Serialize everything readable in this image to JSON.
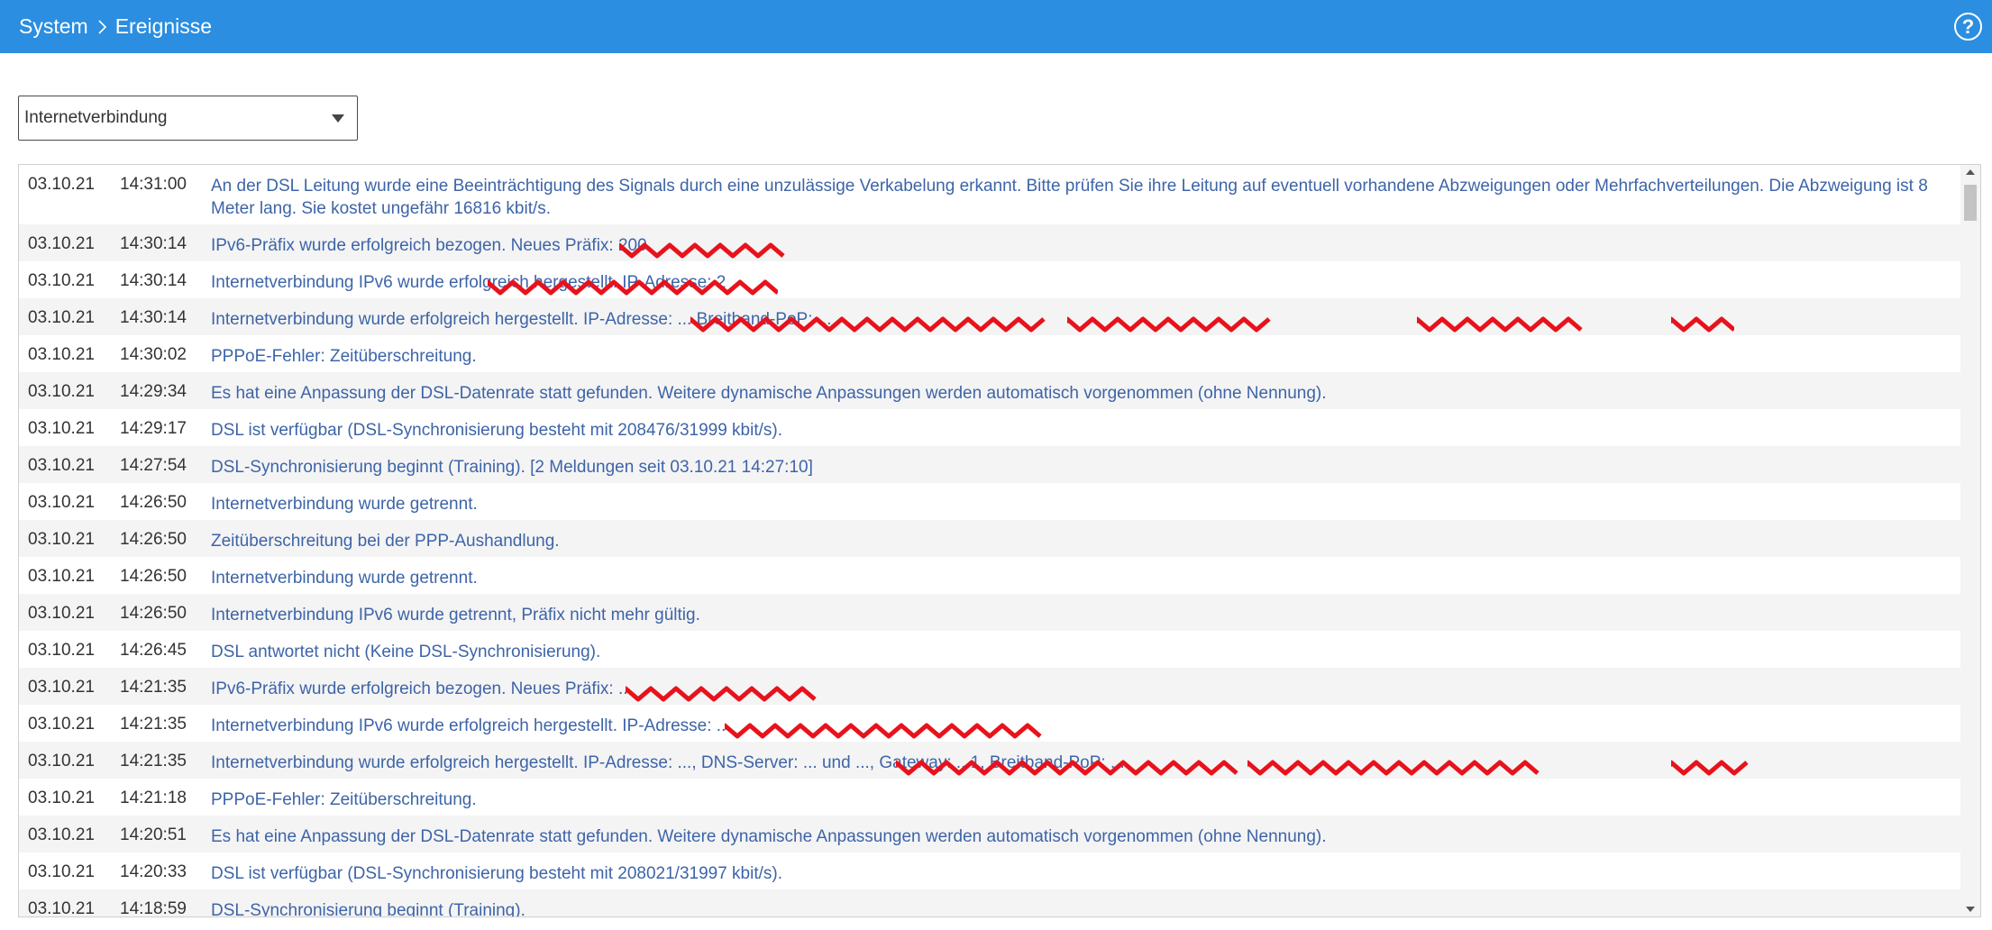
{
  "header": {
    "breadcrumb": [
      "System",
      "Ereignisse"
    ],
    "help_label": "?"
  },
  "filter": {
    "selected": "Internetverbindung"
  },
  "events": [
    {
      "date": "03.10.21",
      "time": "14:31:00",
      "message": "An der DSL Leitung wurde eine Beeinträchtigung des Signals durch eine unzulässige Verkabelung erkannt. Bitte prüfen Sie ihre Leitung auf eventuell vorhandene Abzweigungen oder Mehrfachverteilungen. Die Abzweigung ist 8 Meter lang. Sie kostet ungefähr 16816 kbit/s."
    },
    {
      "date": "03.10.21",
      "time": "14:30:14",
      "message": "IPv6-Präfix wurde erfolgreich bezogen. Neues Präfix: 200"
    },
    {
      "date": "03.10.21",
      "time": "14:30:14",
      "message": "Internetverbindung IPv6 wurde erfolgreich hergestellt. IP-Adresse: 2"
    },
    {
      "date": "03.10.21",
      "time": "14:30:14",
      "message": "Internetverbindung wurde erfolgreich hergestellt. IP-Adresse: ... Breitband-PoP: ..."
    },
    {
      "date": "03.10.21",
      "time": "14:30:02",
      "message": "PPPoE-Fehler: Zeitüberschreitung."
    },
    {
      "date": "03.10.21",
      "time": "14:29:34",
      "message": "Es hat eine Anpassung der DSL-Datenrate statt gefunden. Weitere dynamische Anpassungen werden automatisch vorgenommen (ohne Nennung)."
    },
    {
      "date": "03.10.21",
      "time": "14:29:17",
      "message": "DSL ist verfügbar (DSL-Synchronisierung besteht mit 208476/31999 kbit/s)."
    },
    {
      "date": "03.10.21",
      "time": "14:27:54",
      "message": "DSL-Synchronisierung beginnt (Training). [2 Meldungen seit 03.10.21 14:27:10]"
    },
    {
      "date": "03.10.21",
      "time": "14:26:50",
      "message": "Internetverbindung wurde getrennt."
    },
    {
      "date": "03.10.21",
      "time": "14:26:50",
      "message": "Zeitüberschreitung bei der PPP-Aushandlung."
    },
    {
      "date": "03.10.21",
      "time": "14:26:50",
      "message": "Internetverbindung wurde getrennt."
    },
    {
      "date": "03.10.21",
      "time": "14:26:50",
      "message": "Internetverbindung IPv6 wurde getrennt, Präfix nicht mehr gültig."
    },
    {
      "date": "03.10.21",
      "time": "14:26:45",
      "message": "DSL antwortet nicht (Keine DSL-Synchronisierung)."
    },
    {
      "date": "03.10.21",
      "time": "14:21:35",
      "message": "IPv6-Präfix wurde erfolgreich bezogen. Neues Präfix: ..."
    },
    {
      "date": "03.10.21",
      "time": "14:21:35",
      "message": "Internetverbindung IPv6 wurde erfolgreich hergestellt. IP-Adresse: ..."
    },
    {
      "date": "03.10.21",
      "time": "14:21:35",
      "message": "Internetverbindung wurde erfolgreich hergestellt. IP-Adresse: ..., DNS-Server: ... und ..., Gateway: ...1, Breitband-PoP: ..."
    },
    {
      "date": "03.10.21",
      "time": "14:21:18",
      "message": "PPPoE-Fehler: Zeitüberschreitung."
    },
    {
      "date": "03.10.21",
      "time": "14:20:51",
      "message": "Es hat eine Anpassung der DSL-Datenrate statt gefunden. Weitere dynamische Anpassungen werden automatisch vorgenommen (ohne Nennung)."
    },
    {
      "date": "03.10.21",
      "time": "14:20:33",
      "message": "DSL ist verfügbar (DSL-Synchronisierung besteht mit 208021/31997 kbit/s)."
    },
    {
      "date": "03.10.21",
      "time": "14:18:59",
      "message": "DSL-Synchronisierung beginnt (Training)."
    }
  ],
  "icons": {
    "breadcrumb_separator": "chevron-right-icon",
    "help": "help-icon",
    "dropdown": "caret-down-icon",
    "scroll_up": "scroll-up-arrow-icon",
    "scroll_down": "scroll-down-arrow-icon"
  },
  "colors": {
    "header_bg": "#2b8ee0",
    "message_text": "#3d64a8",
    "row_stripe": "#f4f4f4",
    "redaction": "#e8121c"
  }
}
